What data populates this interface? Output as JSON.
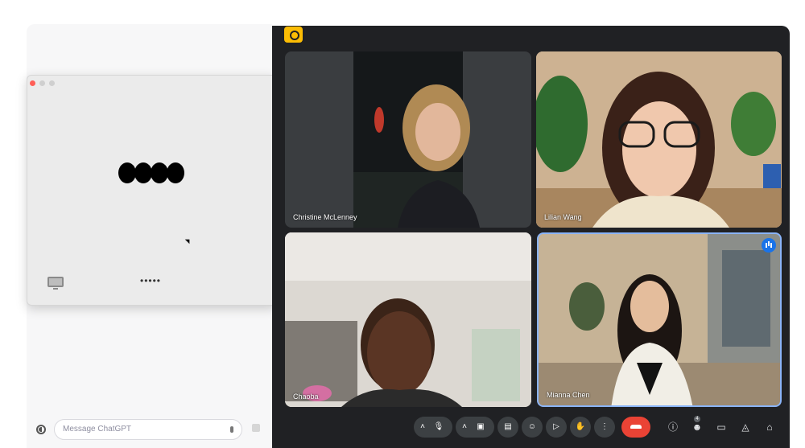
{
  "chatgpt": {
    "composer": {
      "placeholder": "Message ChatGPT"
    }
  },
  "voice_mode": {
    "status_dots": "•••••"
  },
  "meet": {
    "participants": [
      {
        "name": "Christine McLenney",
        "speaking": false
      },
      {
        "name": "Lilian Wang",
        "speaking": false
      },
      {
        "name": "Chaoba",
        "speaking": false
      },
      {
        "name": "Mianna Chen",
        "speaking": true
      }
    ],
    "controls": {
      "icons": [
        "chevron-up-icon",
        "microphone-icon",
        "chevron-up-icon",
        "camera-icon",
        "captions-icon",
        "emoji-icon",
        "present-icon",
        "raise-hand-icon",
        "more-options-icon",
        "end-call-icon"
      ],
      "right_icons": [
        "info-icon",
        "people-icon",
        "chat-icon",
        "activities-icon",
        "host-controls-icon"
      ],
      "participant_count": "4",
      "end_call_color": "#ea4335"
    },
    "accent_color": "#8ab4f8",
    "badge_color": "#fbbc04"
  }
}
